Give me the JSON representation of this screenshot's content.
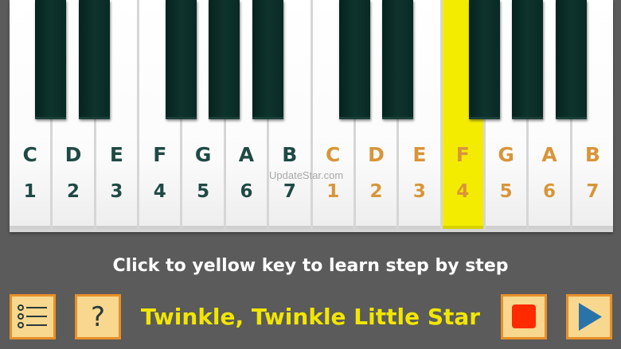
{
  "keyboard": {
    "highlight_color": "#f4ec00",
    "octave1_color": "#1f4a44",
    "octave2_color": "#d8953a",
    "white_keys": [
      {
        "note": "C",
        "number": "1",
        "octave": 1
      },
      {
        "note": "D",
        "number": "2",
        "octave": 1
      },
      {
        "note": "E",
        "number": "3",
        "octave": 1
      },
      {
        "note": "F",
        "number": "4",
        "octave": 1
      },
      {
        "note": "G",
        "number": "5",
        "octave": 1
      },
      {
        "note": "A",
        "number": "6",
        "octave": 1
      },
      {
        "note": "B",
        "number": "7",
        "octave": 1
      },
      {
        "note": "C",
        "number": "1",
        "octave": 2
      },
      {
        "note": "D",
        "number": "2",
        "octave": 2
      },
      {
        "note": "E",
        "number": "3",
        "octave": 2
      },
      {
        "note": "F",
        "number": "4",
        "octave": 2,
        "highlighted": true
      },
      {
        "note": "G",
        "number": "5",
        "octave": 2
      },
      {
        "note": "A",
        "number": "6",
        "octave": 2
      },
      {
        "note": "B",
        "number": "7",
        "octave": 2
      }
    ]
  },
  "watermark": "UpdateStar.com",
  "instruction": "Click to yellow key to learn step by step",
  "controls": {
    "list_icon": "list-icon",
    "help_label": "?",
    "stop_icon": "stop-icon",
    "play_icon": "play-icon",
    "stop_color": "#ff2a00",
    "play_color": "#2a73a8"
  },
  "song": {
    "title": "Twinkle, Twinkle Little Star"
  }
}
